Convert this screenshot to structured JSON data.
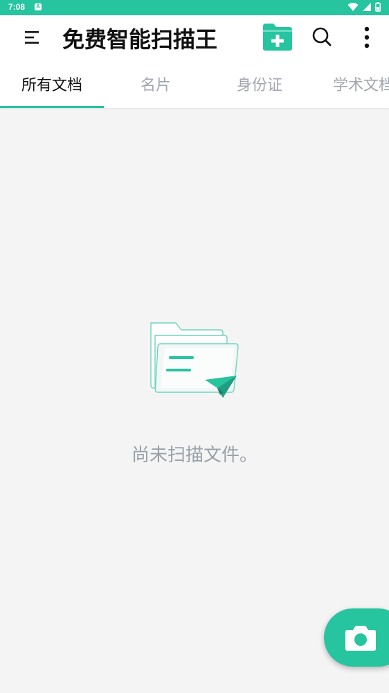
{
  "status_bar": {
    "time": "7:08",
    "notification_letter": "A",
    "icons": [
      "wifi-icon",
      "signal-icon",
      "battery-icon"
    ]
  },
  "app_bar": {
    "title": "免费智能扫描王",
    "icons": [
      "menu-icon",
      "new-folder-icon",
      "search-icon",
      "more-icon"
    ]
  },
  "tabs": [
    {
      "label": "所有文档",
      "active": true
    },
    {
      "label": "名片",
      "active": false
    },
    {
      "label": "身份证",
      "active": false
    },
    {
      "label": "学术文档",
      "active": false
    }
  ],
  "empty_state": {
    "message": "尚未扫描文件。",
    "icon": "empty-folder-illustration"
  },
  "fab": {
    "icon": "camera-icon"
  },
  "colors": {
    "accent": "#27c4a0",
    "background": "#f4f4f4",
    "tab_inactive": "#a2a6ad",
    "empty_text": "#9aa0a8"
  }
}
